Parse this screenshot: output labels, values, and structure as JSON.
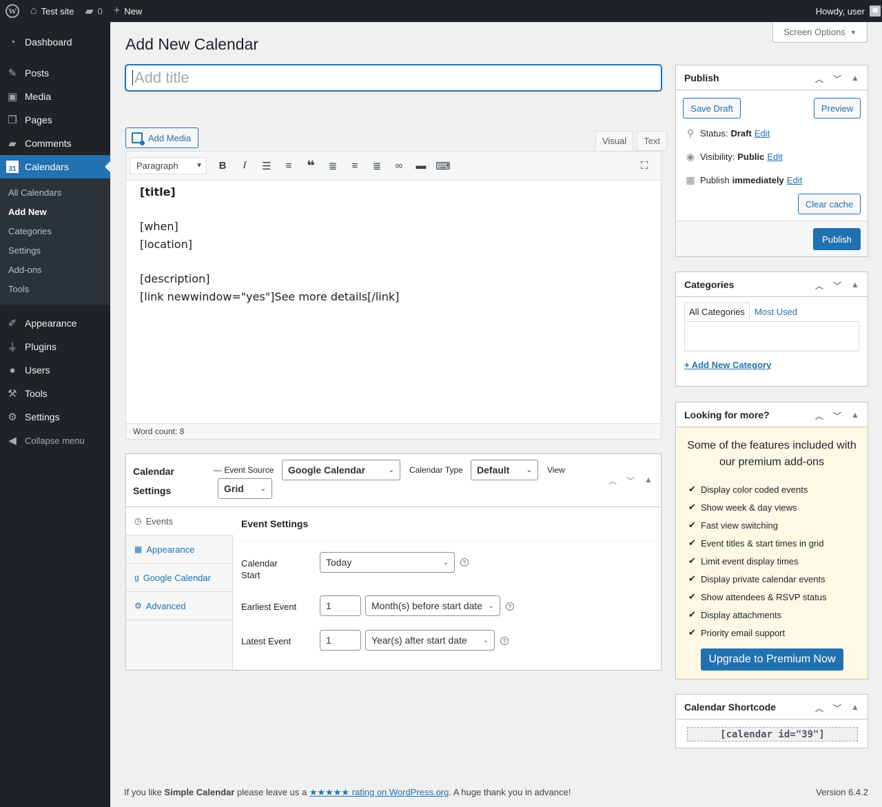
{
  "adminbar": {
    "site_name": "Test site",
    "comment_count": "0",
    "new_label": "New",
    "howdy": "Howdy, user"
  },
  "menu": {
    "dashboard": "Dashboard",
    "posts": "Posts",
    "media": "Media",
    "pages": "Pages",
    "comments": "Comments",
    "calendars": "Calendars",
    "calendar_icon_day": "31",
    "sub": [
      "All Calendars",
      "Add New",
      "Categories",
      "Settings",
      "Add-ons",
      "Tools"
    ],
    "appearance": "Appearance",
    "plugins": "Plugins",
    "users": "Users",
    "tools": "Tools",
    "settings": "Settings",
    "collapse": "Collapse menu"
  },
  "page": {
    "title": "Add New Calendar",
    "screen_options": "Screen Options",
    "title_placeholder": "Add title"
  },
  "editor": {
    "add_media": "Add Media",
    "tab_visual": "Visual",
    "tab_text": "Text",
    "format": "Paragraph",
    "content": {
      "line1": "[title]",
      "line2": "[when]",
      "line3": "[location]",
      "line4": "[description]",
      "line5": "[link newwindow=\"yes\"]See more details[/link]"
    },
    "word_count": "Word count: 8"
  },
  "calendar_settings": {
    "title": "Calendar Settings",
    "event_source_label": "— Event Source",
    "event_source_value": "Google Calendar",
    "calendar_type_label": "Calendar Type",
    "calendar_type_value": "Default",
    "view_label": "View",
    "view_value": "Grid",
    "tabs": [
      "Events",
      "Appearance",
      "Google Calendar",
      "Advanced"
    ],
    "panel_title": "Event Settings",
    "calendar_start_label": "Calendar Start",
    "calendar_start_value": "Today",
    "earliest_event_label": "Earliest Event",
    "earliest_event_number": "1",
    "earliest_event_unit": "Month(s) before start date",
    "latest_event_label": "Latest Event",
    "latest_event_number": "1",
    "latest_event_unit": "Year(s) after start date"
  },
  "publish": {
    "title": "Publish",
    "save_draft": "Save Draft",
    "preview": "Preview",
    "status_label": "Status:",
    "status_value": "Draft",
    "visibility_label": "Visibility:",
    "visibility_value": "Public",
    "publish_label": "Publish",
    "publish_value": "immediately",
    "edit": "Edit",
    "clear_cache": "Clear cache",
    "publish_button": "Publish"
  },
  "categories": {
    "title": "Categories",
    "tab_all": "All Categories",
    "tab_most_used": "Most Used",
    "add_new": "+ Add New Category"
  },
  "premium": {
    "title": "Looking for more?",
    "intro": "Some of the features included with our premium add-ons",
    "features": [
      "Display color coded events",
      "Show week & day views",
      "Fast view switching",
      "Event titles & start times in grid",
      "Limit event display times",
      "Display private calendar events",
      "Show attendees & RSVP status",
      "Display attachments",
      "Priority email support"
    ],
    "upgrade": "Upgrade to Premium Now"
  },
  "shortcode": {
    "title": "Calendar Shortcode",
    "value": "[calendar id=\"39\"]"
  },
  "footer": {
    "text_before": "If you like ",
    "plugin_name": "Simple Calendar",
    "text_middle": " please leave us a ",
    "link": "★★★★★ rating on WordPress.org",
    "text_after": ". A huge thank you in advance!",
    "version": "Version 6.4.2"
  }
}
